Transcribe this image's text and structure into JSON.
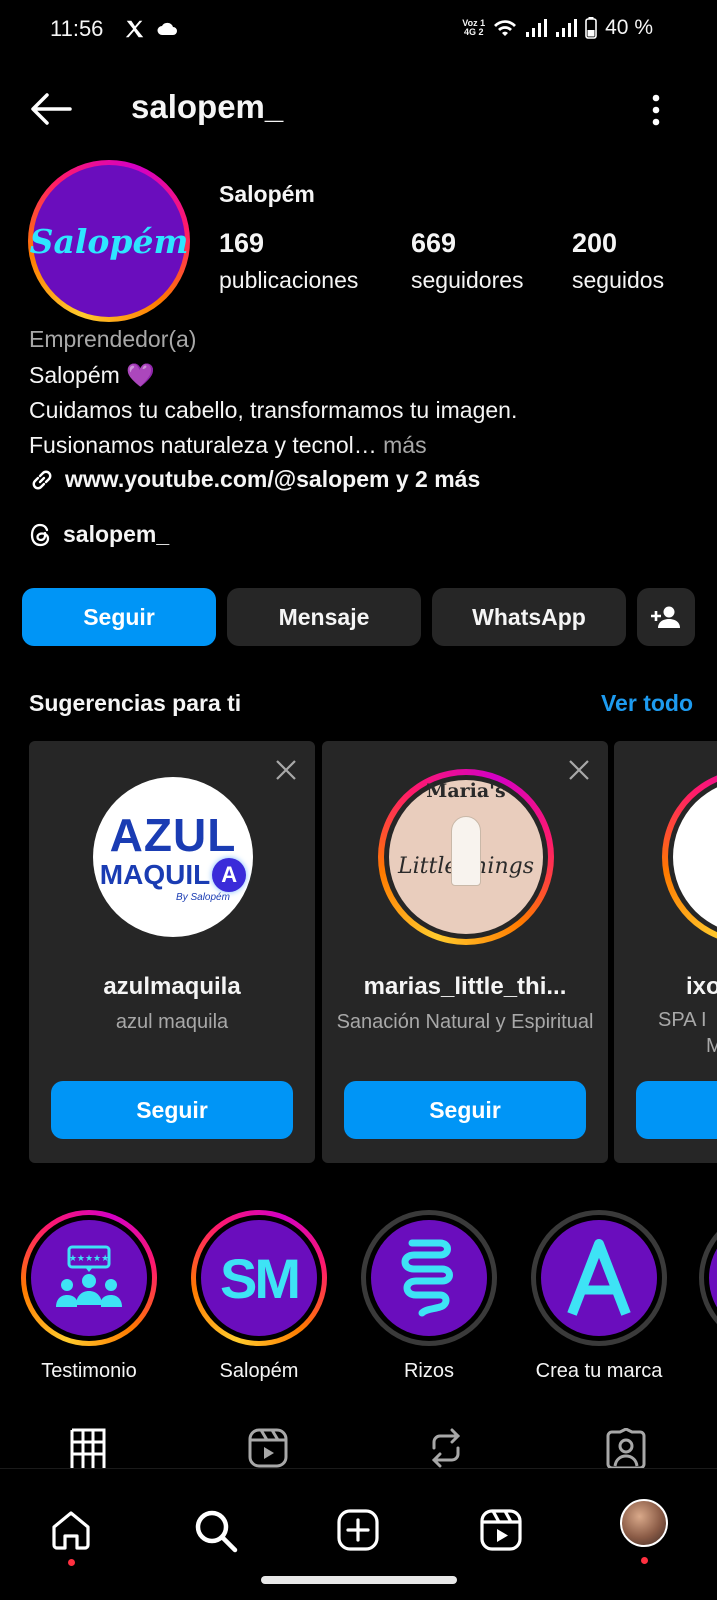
{
  "status_bar": {
    "time": "11:56",
    "battery": "40 %",
    "voz": "Voz 1",
    "net": "4G 2"
  },
  "header": {
    "username": "salopem_"
  },
  "profile": {
    "display_name": "Salopém",
    "avatar_text": "Salopém",
    "stats": [
      {
        "value": "169",
        "label": "publicaciones"
      },
      {
        "value": "669",
        "label": "seguidores"
      },
      {
        "value": "200",
        "label": "seguidos"
      }
    ],
    "category": "Emprendedor(a)",
    "bio_name": "Salopém 💜",
    "bio_line1": "Cuidamos tu cabello, transformamos tu imagen.",
    "bio_line2": "Fusionamos naturaleza y tecnol…",
    "bio_more": " más",
    "link": "www.youtube.com/@salopem y 2 más",
    "threads": "salopem_"
  },
  "actions": {
    "follow": "Seguir",
    "message": "Mensaje",
    "whatsapp": "WhatsApp"
  },
  "suggestions": {
    "title": "Sugerencias para ti",
    "see_all": "Ver todo",
    "cards": [
      {
        "username": "azulmaquila",
        "subtitle": "azul maquila",
        "button": "Seguir",
        "pic_line1": "AZUL",
        "pic_line2": "MAQUIL",
        "pic_badge": "A",
        "pic_by": "By Salopém"
      },
      {
        "username": "marias_little_thi...",
        "subtitle": "Sanación Natural y Espiritual",
        "button": "Seguir",
        "pic_title": "Maria's",
        "pic_script": "Little things"
      },
      {
        "username": "ixo",
        "subtitle": "SPA I",
        "subtitle2": "M"
      }
    ]
  },
  "highlights": [
    {
      "label": "Testimonio",
      "icon": "reviews-icon"
    },
    {
      "label": "Salopém",
      "icon": "sm-monogram",
      "text": "SM"
    },
    {
      "label": "Rizos",
      "icon": "curl-icon"
    },
    {
      "label": "Crea tu marca",
      "icon": "letter-a-icon",
      "text": "A"
    }
  ],
  "colors": {
    "accent": "#0095f6",
    "link": "#1d9bf0",
    "button_dark": "#262626",
    "highlight_bg": "#6a0dbd",
    "cyan": "#2ee6ff"
  }
}
